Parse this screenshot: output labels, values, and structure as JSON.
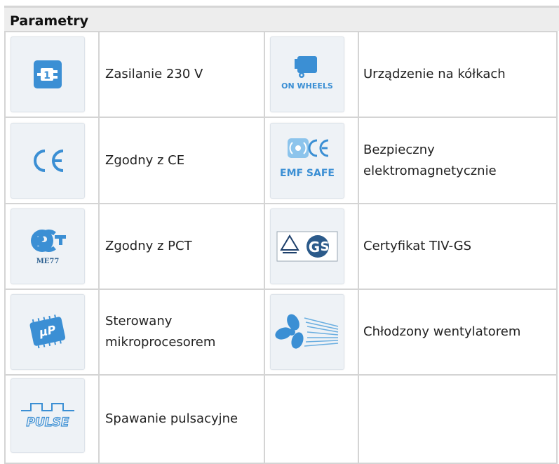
{
  "title": "Parametry",
  "features": [
    {
      "icon": "power-plug-icon",
      "label": "Zasilanie 230 V"
    },
    {
      "icon": "on-wheels-icon",
      "label": "Urządzenie na kółkach",
      "icon_text": "ON WHEELS"
    },
    {
      "icon": "ce-mark-icon",
      "label": "Zgodny z CE"
    },
    {
      "icon": "emf-safe-icon",
      "label": "Bezpieczny elektromagnetycznie",
      "icon_text": "EMF SAFE"
    },
    {
      "icon": "pct-mark-icon",
      "label": "Zgodny z PCT",
      "icon_text": "ME77"
    },
    {
      "icon": "tiv-gs-icon",
      "label": "Certyfikat TIV-GS"
    },
    {
      "icon": "microprocessor-icon",
      "label": "Sterowany mikroprocesorem"
    },
    {
      "icon": "fan-icon",
      "label": "Chłodzony wentylatorem"
    },
    {
      "icon": "pulse-icon",
      "label": "Spawanie pulsacyjne",
      "icon_text": "PULSE"
    }
  ],
  "colors": {
    "icon_blue": "#3b8fd4",
    "border": "#d4d4d4",
    "header_bg": "#ededed"
  }
}
